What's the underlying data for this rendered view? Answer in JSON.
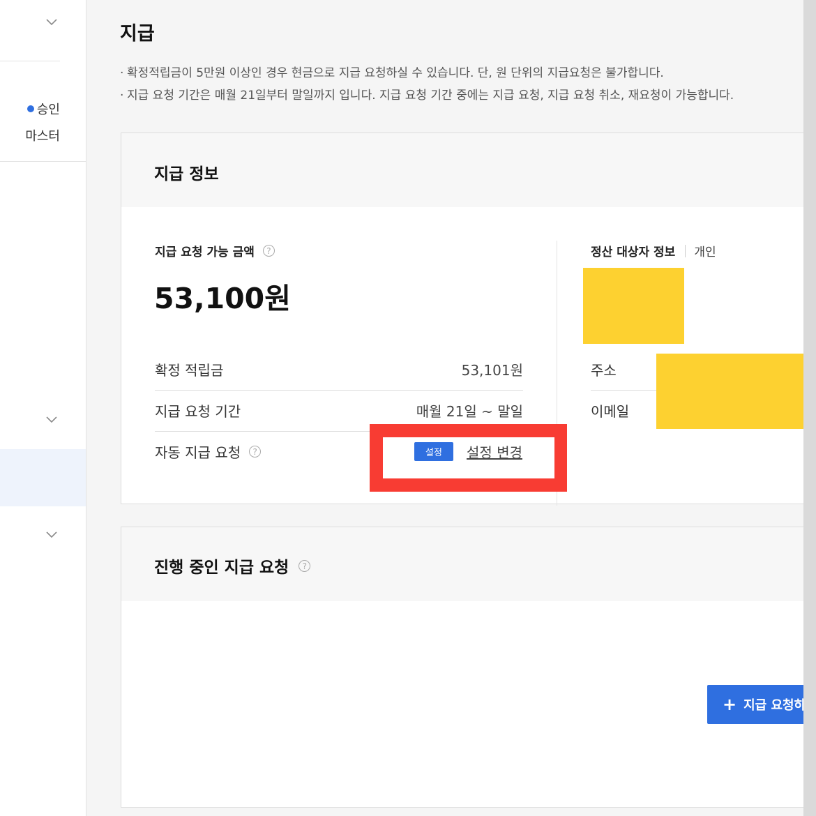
{
  "sidebar": {
    "status_label": "승인",
    "grade_label": "마스터"
  },
  "page": {
    "title": "지급",
    "notices": [
      "확정적립금이 5만원 이상인 경우 현금으로 지급 요청하실 수 있습니다. 단, 원 단위의 지급요청은 불가합니다.",
      "지급 요청 기간은 매월 21일부터 말일까지 입니다. 지급 요청 기간 중에는 지급 요청, 지급 요청 취소, 재요청이 가능합니다."
    ]
  },
  "payment_info": {
    "title": "지급 정보",
    "available_label": "지급 요청 가능 금액",
    "available_amount": "53,100원",
    "rows": [
      {
        "label": "확정 적립금",
        "value": "53,101원"
      },
      {
        "label": "지급 요청 기간",
        "value": "매월 21일 ~ 말일"
      }
    ],
    "auto_label": "자동 지급 요청",
    "auto_badge": "설정",
    "auto_change_link": "설정 변경"
  },
  "payee": {
    "title": "정산 대상자 정보",
    "type": "개인",
    "address_label": "주소",
    "email_label": "이메일"
  },
  "pending": {
    "title": "진행 중인 지급 요청",
    "request_button": "지급 요청하기"
  },
  "colors": {
    "accent": "#2f6fe0",
    "highlight": "#f83c33",
    "redaction": "#fdd130"
  }
}
